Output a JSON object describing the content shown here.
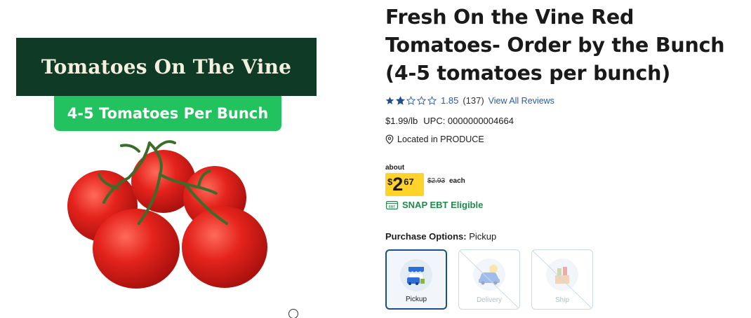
{
  "image": {
    "banner_text": "Tomatoes On The Vine",
    "pill_text": "4-5 Tomatoes Per Bunch"
  },
  "product": {
    "title": "Fresh On the Vine Red Tomatoes- Order by the Bunch (4-5 tomatoes per bunch)",
    "rating_value": "1.85",
    "rating_stars": 1.85,
    "rating_max": 5,
    "review_count": "(137)",
    "view_reviews_label": "View All Reviews",
    "unit_price": "$1.99/lb",
    "upc": "UPC: 0000000004664",
    "location": "Located in PRODUCE"
  },
  "price": {
    "about_label": "about",
    "dollar_sign": "$",
    "whole": "2",
    "cents": "67",
    "original": "$2.93",
    "each_label": "each"
  },
  "snap": {
    "label": "SNAP EBT Eligible",
    "badge_text": "EBT"
  },
  "purchase": {
    "label": "Purchase Options:",
    "selected": "Pickup",
    "options": [
      {
        "label": "Pickup",
        "enabled": true,
        "selected": true,
        "icon": "store-pickup-icon"
      },
      {
        "label": "Delivery",
        "enabled": false,
        "selected": false,
        "icon": "delivery-car-icon"
      },
      {
        "label": "Ship",
        "enabled": false,
        "selected": false,
        "icon": "ship-box-icon"
      }
    ]
  },
  "colors": {
    "banner_bg": "#0f3b26",
    "pill_bg": "#22c35e",
    "price_tag": "#ffd42a",
    "link_blue": "#2a5aa8",
    "snap_green": "#1f8a4c",
    "selected_border": "#1c4f8a"
  }
}
